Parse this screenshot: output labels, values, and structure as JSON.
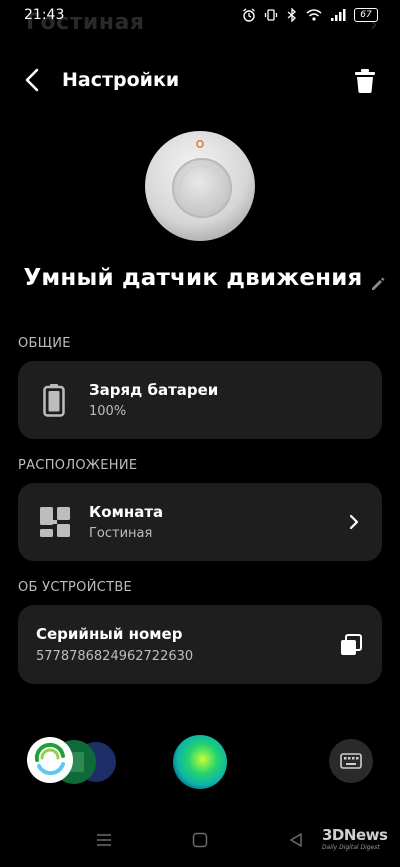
{
  "status_bar": {
    "time": "21:43",
    "battery": "67",
    "ghost_title": "Гостиная"
  },
  "header": {
    "title": "Настройки"
  },
  "device": {
    "name": "Умный датчик движения"
  },
  "sections": {
    "general": {
      "label": "ОБЩИЕ",
      "battery_title": "Заряд батареи",
      "battery_value": "100%"
    },
    "location": {
      "label": "РАСПОЛОЖЕНИЕ",
      "room_title": "Комната",
      "room_value": "Гостиная"
    },
    "about": {
      "label": "ОБ УСТРОЙСТВЕ",
      "serial_title": "Серийный номер",
      "serial_value": "5778786824962722630"
    }
  },
  "watermark": {
    "big": "3DNews",
    "small": "Daily Digital Digest"
  },
  "colors": {
    "background": "#000000",
    "card": "#1e1e1e",
    "text": "#ffffff",
    "secondary_text": "#bdbdbd",
    "device_led": "#e07a3a"
  },
  "icons": {
    "back": "back-arrow-icon",
    "trash": "trash-icon",
    "edit": "pencil-icon",
    "battery": "battery-icon",
    "room": "room-layout-icon",
    "chevron": "chevron-right-icon",
    "copy": "copy-icon",
    "keyboard": "keyboard-icon"
  }
}
